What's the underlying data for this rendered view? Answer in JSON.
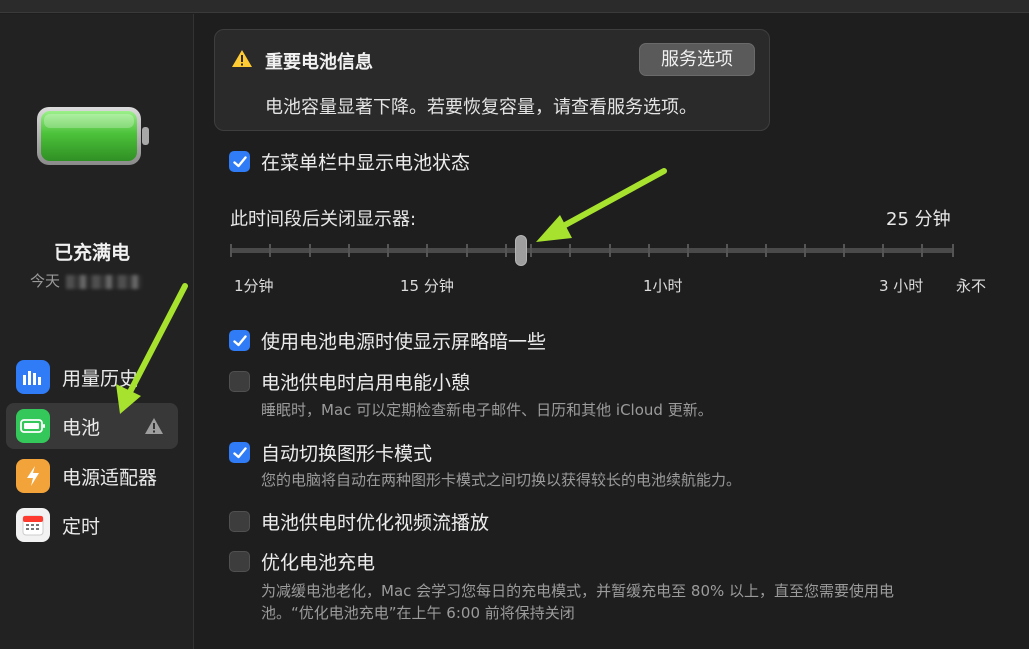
{
  "sidebar": {
    "status_title": "已充满电",
    "status_time": "今天",
    "items": [
      {
        "label": "用量历史"
      },
      {
        "label": "电池"
      },
      {
        "label": "电源适配器"
      },
      {
        "label": "定时"
      }
    ]
  },
  "notice": {
    "title": "重要电池信息",
    "body": "电池容量显著下降。若要恢复容量，请查看服务选项。",
    "button": "服务选项"
  },
  "menu_bar_option": {
    "label": "在菜单栏中显示电池状态",
    "checked": true
  },
  "display_off": {
    "label": "此时间段后关闭显示器:",
    "value": "25 分钟",
    "ticks": [
      "1分钟",
      "15 分钟",
      "1小时",
      "3 小时",
      "永不"
    ]
  },
  "options": [
    {
      "label": "使用电池电源时使显示屏略暗一些",
      "checked": true,
      "hint": ""
    },
    {
      "label": "电池供电时启用电能小憩",
      "checked": false,
      "hint": "睡眠时，Mac 可以定期检查新电子邮件、日历和其他 iCloud 更新。"
    },
    {
      "label": "自动切换图形卡模式",
      "checked": true,
      "hint": "您的电脑将自动在两种图形卡模式之间切换以获得较长的电池续航能力。"
    },
    {
      "label": "电池供电时优化视频流播放",
      "checked": false,
      "hint": ""
    },
    {
      "label": "优化电池充电",
      "checked": false,
      "hint_line1": "为减缓电池老化，Mac 会学习您每日的充电模式，并暂缓充电至 80% 以上，直至您需要使用电",
      "hint_line2": "池。“优化电池充电”在上午 6:00 前将保持关闭"
    }
  ],
  "colors": {
    "accent": "#2f7cf6",
    "annotation_arrow": "#a6e22e",
    "battery_green": "#5fd04a"
  }
}
